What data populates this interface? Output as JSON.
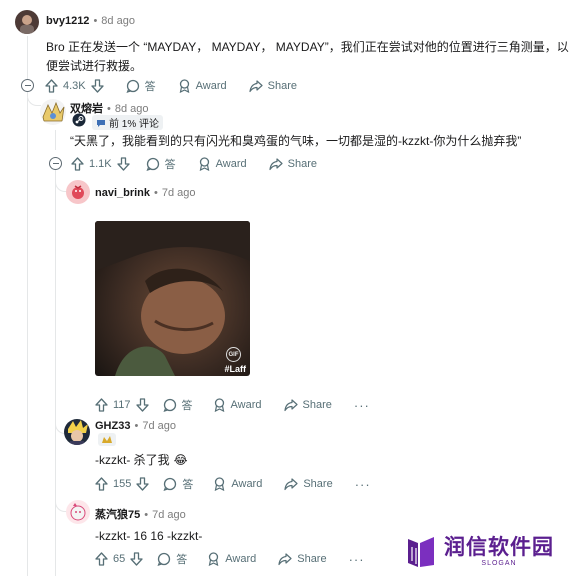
{
  "comments": {
    "c1": {
      "username": "bvy1212",
      "time": "8d ago",
      "text": "Bro 正在发送一个 “MAYDAY， MAYDAY， MAYDAY”，我们正在尝试对他的位置进行三角测量，以便尝试进行救援。",
      "votes": "4.3K",
      "reply_label": "答",
      "award_label": "Award",
      "share_label": "Share"
    },
    "c2": {
      "username": "双熔岩",
      "time": "8d ago",
      "badge": "前 1% 评论",
      "text": "“天黑了，我能看到的只有闪光和臭鸡蛋的气味，一切都是湿的-kzzkt-你为什么抛弃我”",
      "votes": "1.1K",
      "reply_label": "答",
      "award_label": "Award",
      "share_label": "Share"
    },
    "c3": {
      "username": "navi_brink",
      "time": "7d ago",
      "gif_badge": "GIF",
      "gif_caption": "#Laff",
      "votes": "117",
      "reply_label": "答",
      "award_label": "Award",
      "share_label": "Share",
      "more": "···"
    },
    "c4": {
      "username": "GHZ33",
      "time": "7d ago",
      "text": "-kzzkt- 杀了我",
      "emoji": "😂",
      "votes": "155",
      "reply_label": "答",
      "award_label": "Award",
      "share_label": "Share",
      "more": "···"
    },
    "c5": {
      "username": "蒸汽狼75",
      "time": "7d ago",
      "text": "-kzzkt- 16 16 -kzzkt-",
      "votes": "65",
      "reply_label": "答",
      "award_label": "Award",
      "share_label": "Share",
      "more": "···"
    }
  },
  "watermark": {
    "title": "润信软件园",
    "slogan": "SLOGAN"
  },
  "colors": {
    "meta": "#7c7c7c",
    "icon": "#576f76",
    "thread": "#e5e7e8",
    "watermark_purple": "#5b1f8f"
  }
}
